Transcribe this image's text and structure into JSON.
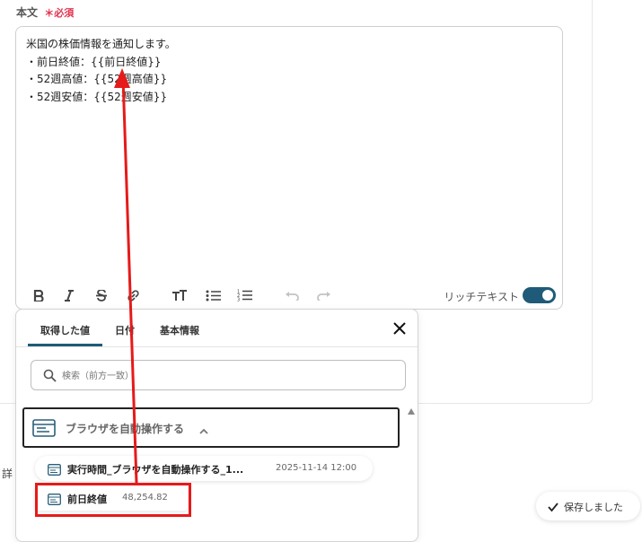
{
  "field": {
    "label": "本文",
    "required": "＊必須"
  },
  "editor": {
    "lines": [
      "米国の株価情報を通知します。",
      "・前日終値：{{前日終値}}",
      "・52週高値：{{52週高値}}",
      "・52週安値：{{52週安値}}"
    ],
    "rich_text_label": "リッチテキスト",
    "rich_text_enabled": true
  },
  "popup": {
    "tabs": [
      "取得した値",
      "日付",
      "基本情報"
    ],
    "active_tab": "取得した値",
    "search_placeholder": "検索（前方一致）",
    "group_label": "ブラウザを自動操作する",
    "items": [
      {
        "label": "実行時間_ブラウザを自動操作する_1...",
        "value": "2025-11-14 12:00"
      },
      {
        "label": "前日終値",
        "value": "48,254.82"
      }
    ]
  },
  "side_text": "詳",
  "status": {
    "saved_label": "保存しました"
  },
  "colors": {
    "accent": "#1f5b78",
    "required": "#e0344f",
    "annotation": "#e61a1a"
  }
}
